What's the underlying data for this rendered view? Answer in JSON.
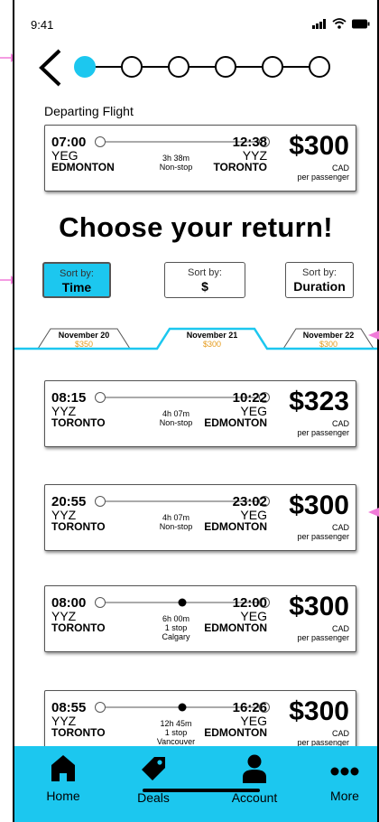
{
  "status": {
    "time": "9:41"
  },
  "stepper": {
    "steps": 6,
    "active": 1
  },
  "departing": {
    "label": "Departing Flight",
    "dep_time": "07:00",
    "dep_code": "YEG",
    "dep_city": "EDMONTON",
    "arr_time": "12:38",
    "arr_code": "YYZ",
    "arr_city": "TORONTO",
    "duration": "3h 38m",
    "stops": "Non-stop",
    "price": "$300",
    "currency": "CAD",
    "per": "per passenger"
  },
  "heading": "Choose your return!",
  "sort": [
    {
      "top": "Sort by:",
      "value": "Time",
      "active": true
    },
    {
      "top": "Sort by:",
      "value": "$",
      "active": false
    },
    {
      "top": "Sort by:",
      "value": "Duration",
      "active": false
    }
  ],
  "date_tabs": [
    {
      "label": "November 20",
      "price": "$350"
    },
    {
      "label": "November 21",
      "price": "$300"
    },
    {
      "label": "November 22",
      "price": "$300"
    }
  ],
  "flights": [
    {
      "dep_time": "08:15",
      "dep_code": "YYZ",
      "dep_city": "TORONTO",
      "arr_time": "10:22",
      "arr_code": "YEG",
      "arr_city": "EDMONTON",
      "duration": "4h 07m",
      "stops": "Non-stop",
      "via": "",
      "price": "$323",
      "currency": "CAD",
      "per": "per passenger",
      "has_stop": false
    },
    {
      "dep_time": "20:55",
      "dep_code": "YYZ",
      "dep_city": "TORONTO",
      "arr_time": "23:02",
      "arr_code": "YEG",
      "arr_city": "EDMONTON",
      "duration": "4h 07m",
      "stops": "Non-stop",
      "via": "",
      "price": "$300",
      "currency": "CAD",
      "per": "per passenger",
      "has_stop": false
    },
    {
      "dep_time": "08:00",
      "dep_code": "YYZ",
      "dep_city": "TORONTO",
      "arr_time": "12:00",
      "arr_code": "YEG",
      "arr_city": "EDMONTON",
      "duration": "6h 00m",
      "stops": "1 stop",
      "via": "Calgary",
      "price": "$300",
      "currency": "CAD",
      "per": "per passenger",
      "has_stop": true
    },
    {
      "dep_time": "08:55",
      "dep_code": "YYZ",
      "dep_city": "TORONTO",
      "arr_time": "16:26",
      "arr_code": "YEG",
      "arr_city": "EDMONTON",
      "duration": "12h 45m",
      "stops": "1 stop",
      "via": "Vancouver",
      "price": "$300",
      "currency": "CAD",
      "per": "per passenger",
      "has_stop": true
    }
  ],
  "nav": [
    {
      "label": "Home",
      "icon": "home-icon"
    },
    {
      "label": "Deals",
      "icon": "tag-icon"
    },
    {
      "label": "Account",
      "icon": "person-icon"
    },
    {
      "label": "More",
      "icon": "more-icon"
    }
  ],
  "colors": {
    "accent": "#1cc7ef",
    "price_orange": "#e59a1a",
    "annotation": "#f07ad8"
  }
}
